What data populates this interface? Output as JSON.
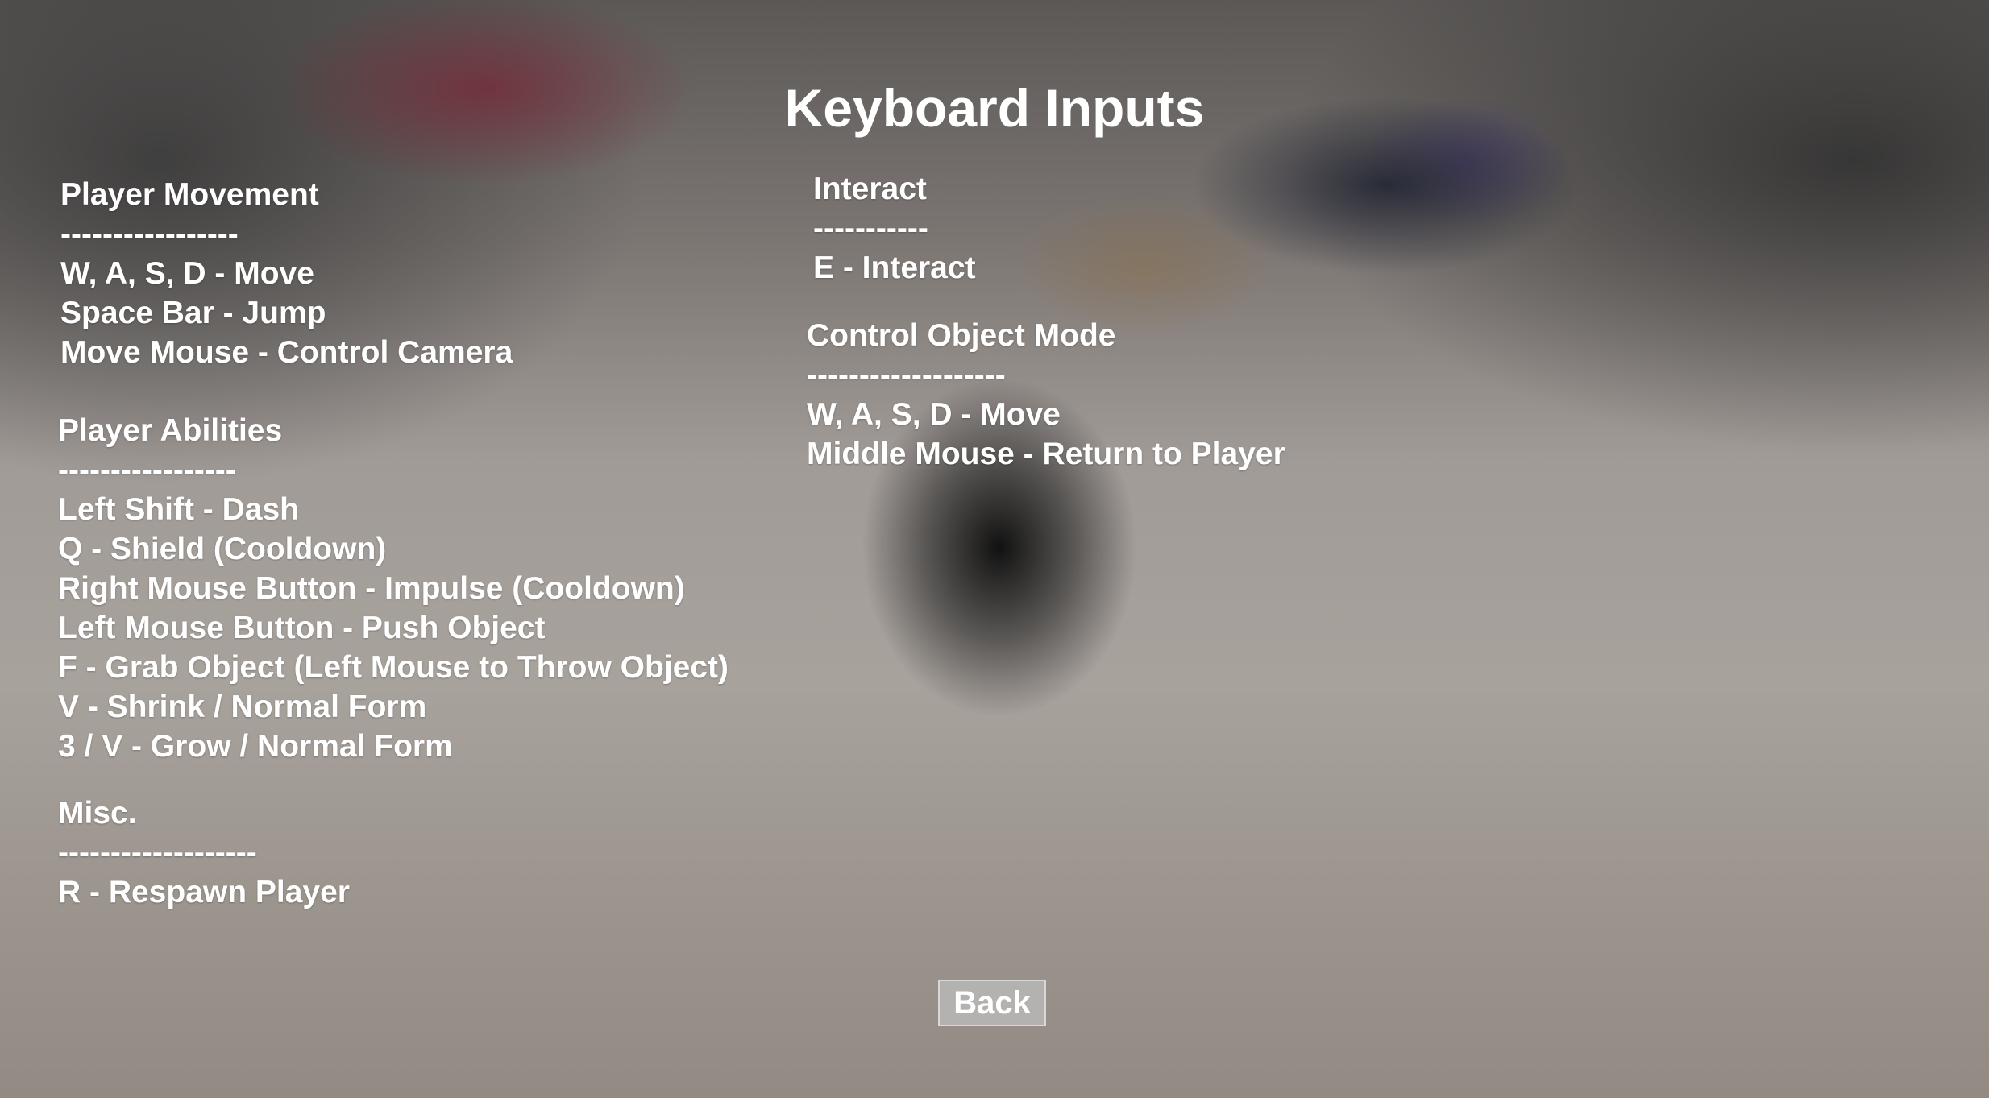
{
  "title": "Keyboard Inputs",
  "sections": {
    "player_movement": {
      "heading": "Player Movement",
      "divider": "-----------------",
      "items": [
        "W, A, S, D - Move",
        "Space Bar - Jump",
        "Move Mouse - Control Camera"
      ]
    },
    "player_abilities": {
      "heading": "Player Abilities",
      "divider": "-----------------",
      "items": [
        "Left Shift - Dash",
        "Q - Shield (Cooldown)",
        "Right Mouse Button - Impulse (Cooldown)",
        "Left Mouse Button - Push Object",
        "F - Grab Object (Left Mouse to Throw Object)",
        "V - Shrink / Normal Form",
        "3 / V - Grow / Normal Form"
      ]
    },
    "misc": {
      "heading": "Misc.",
      "divider": "-------------------",
      "items": [
        "R - Respawn Player"
      ]
    },
    "interact": {
      "heading": "Interact",
      "divider": "-----------",
      "items": [
        "E - Interact"
      ]
    },
    "control_object_mode": {
      "heading": "Control Object Mode",
      "divider": "-------------------",
      "items": [
        "W, A, S, D - Move",
        "Middle Mouse - Return to Player"
      ]
    }
  },
  "back_button": {
    "label": "Back"
  }
}
